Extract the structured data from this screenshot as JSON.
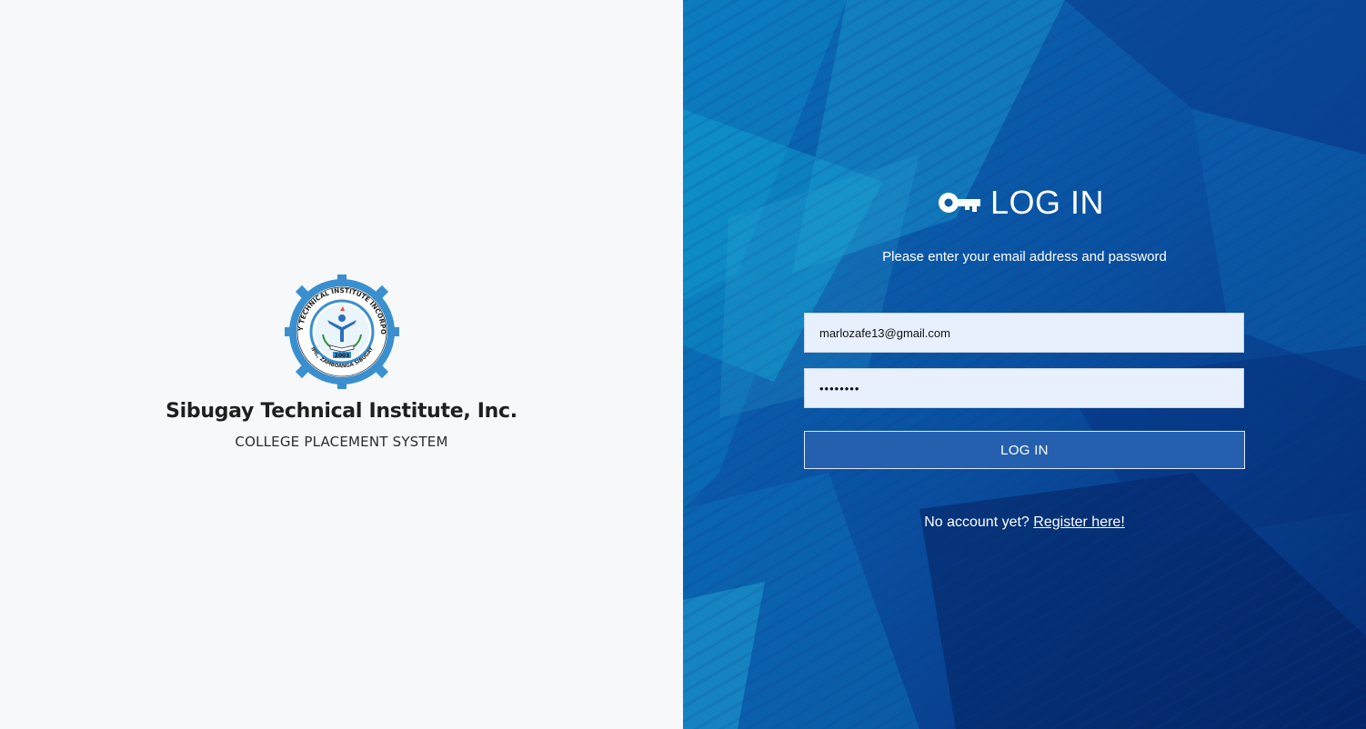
{
  "brand": {
    "school_name": "Sibugay Technical Institute, Inc.",
    "system_name": "COLLEGE PLACEMENT SYSTEM",
    "logo": {
      "ring_text_top": "SIBUGAY TECHNICAL INSTITUTE INCORPORATED",
      "ring_text_bottom": "IPIL, ZAMBOANGA SIBUGAY",
      "year": "2003"
    }
  },
  "login": {
    "title": "LOG IN",
    "icon": "key-icon",
    "subtitle": "Please enter your email address and password",
    "email_value": "marlozafe13@gmail.com",
    "password_value": "••••••••",
    "button_label": "LOG IN",
    "register_prompt": "No account yet?",
    "register_link": "Register here!"
  },
  "colors": {
    "left_bg": "#f6f8fa",
    "right_bg": "#0b3f8f",
    "button_bg": "#2560ae",
    "field_bg": "#e8f0fe"
  }
}
